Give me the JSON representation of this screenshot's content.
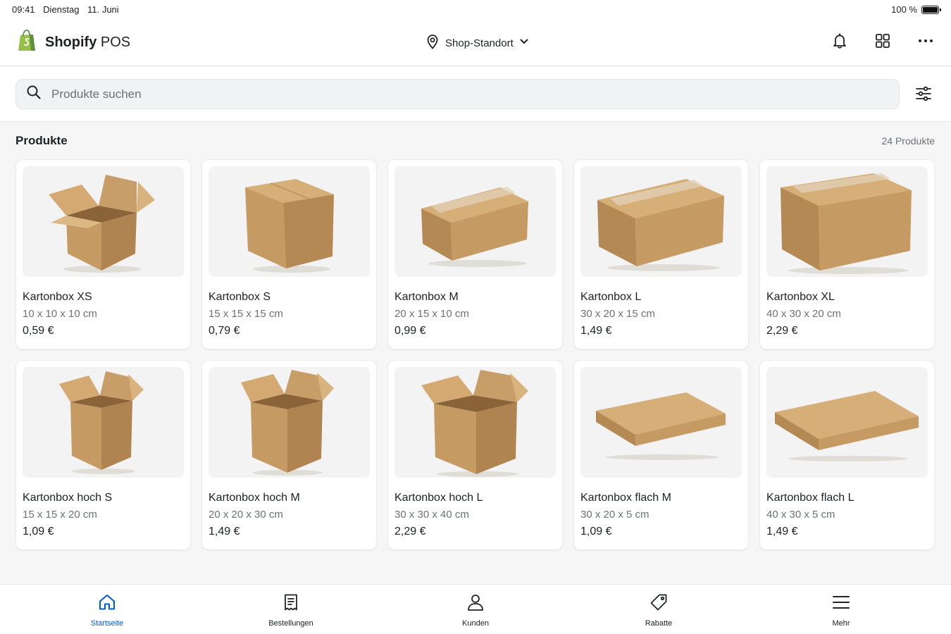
{
  "status_bar": {
    "time": "09:41",
    "day": "Dienstag",
    "date": "11. Juni",
    "battery": "100 %"
  },
  "header": {
    "brand_bold": "Shopify",
    "brand_rest": "POS",
    "location": "Shop-Standort"
  },
  "search": {
    "placeholder": "Produkte suchen"
  },
  "products_section": {
    "title": "Produkte",
    "count": "24 Produkte"
  },
  "products": [
    {
      "name": "Kartonbox XS",
      "dims": "10 x 10 x 10 cm",
      "price": "0,59 €"
    },
    {
      "name": "Kartonbox S",
      "dims": "15 x 15 x 15 cm",
      "price": "0,79 €"
    },
    {
      "name": "Kartonbox M",
      "dims": "20 x 15 x 10 cm",
      "price": "0,99 €"
    },
    {
      "name": "Kartonbox L",
      "dims": "30 x 20 x 15 cm",
      "price": "1,49 €"
    },
    {
      "name": "Kartonbox XL",
      "dims": "40 x 30 x 20 cm",
      "price": "2,29 €"
    },
    {
      "name": "Kartonbox hoch S",
      "dims": "15 x 15 x 20 cm",
      "price": "1,09 €"
    },
    {
      "name": "Kartonbox hoch M",
      "dims": "20 x 20 x 30 cm",
      "price": "1,49 €"
    },
    {
      "name": "Kartonbox hoch L",
      "dims": "30 x 30 x 40 cm",
      "price": "2,29 €"
    },
    {
      "name": "Kartonbox flach M",
      "dims": "30 x 20 x 5 cm",
      "price": "1,09 €"
    },
    {
      "name": "Kartonbox flach L",
      "dims": "40 x 30 x 5 cm",
      "price": "1,49 €"
    }
  ],
  "tabs": [
    {
      "label": "Startseite",
      "icon": "home-icon",
      "active": true
    },
    {
      "label": "Bestellungen",
      "icon": "receipt-icon",
      "active": false
    },
    {
      "label": "Kunden",
      "icon": "person-icon",
      "active": false
    },
    {
      "label": "Rabatte",
      "icon": "tag-icon",
      "active": false
    },
    {
      "label": "Mehr",
      "icon": "menu-icon",
      "active": false
    }
  ],
  "colors": {
    "accent": "#005bd3",
    "shopify_green": "#95bf47",
    "cardboard": "#c9a06a"
  }
}
